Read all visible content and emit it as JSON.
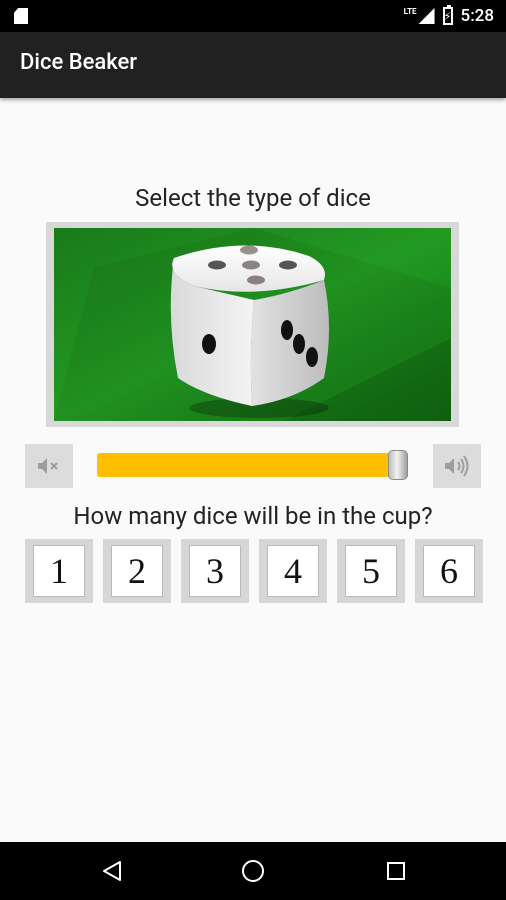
{
  "status_bar": {
    "network_label": "LTE",
    "time": "5:28"
  },
  "app_bar": {
    "title": "Dice Beaker"
  },
  "dice_type": {
    "prompt": "Select the type of dice"
  },
  "volume": {
    "level": 0.97,
    "mute_icon": "volume-mute-icon",
    "loud_icon": "volume-up-icon"
  },
  "dice_count": {
    "prompt": "How many dice will be in the cup?",
    "options": [
      "1",
      "2",
      "3",
      "4",
      "5",
      "6"
    ]
  },
  "colors": {
    "accent": "#ffbf00",
    "felt": "#1f8a1f",
    "app_bar": "#212121",
    "background": "#fafafa"
  },
  "nav_bar": {
    "back_icon": "back-icon",
    "home_icon": "home-icon",
    "recents_icon": "recents-icon"
  }
}
